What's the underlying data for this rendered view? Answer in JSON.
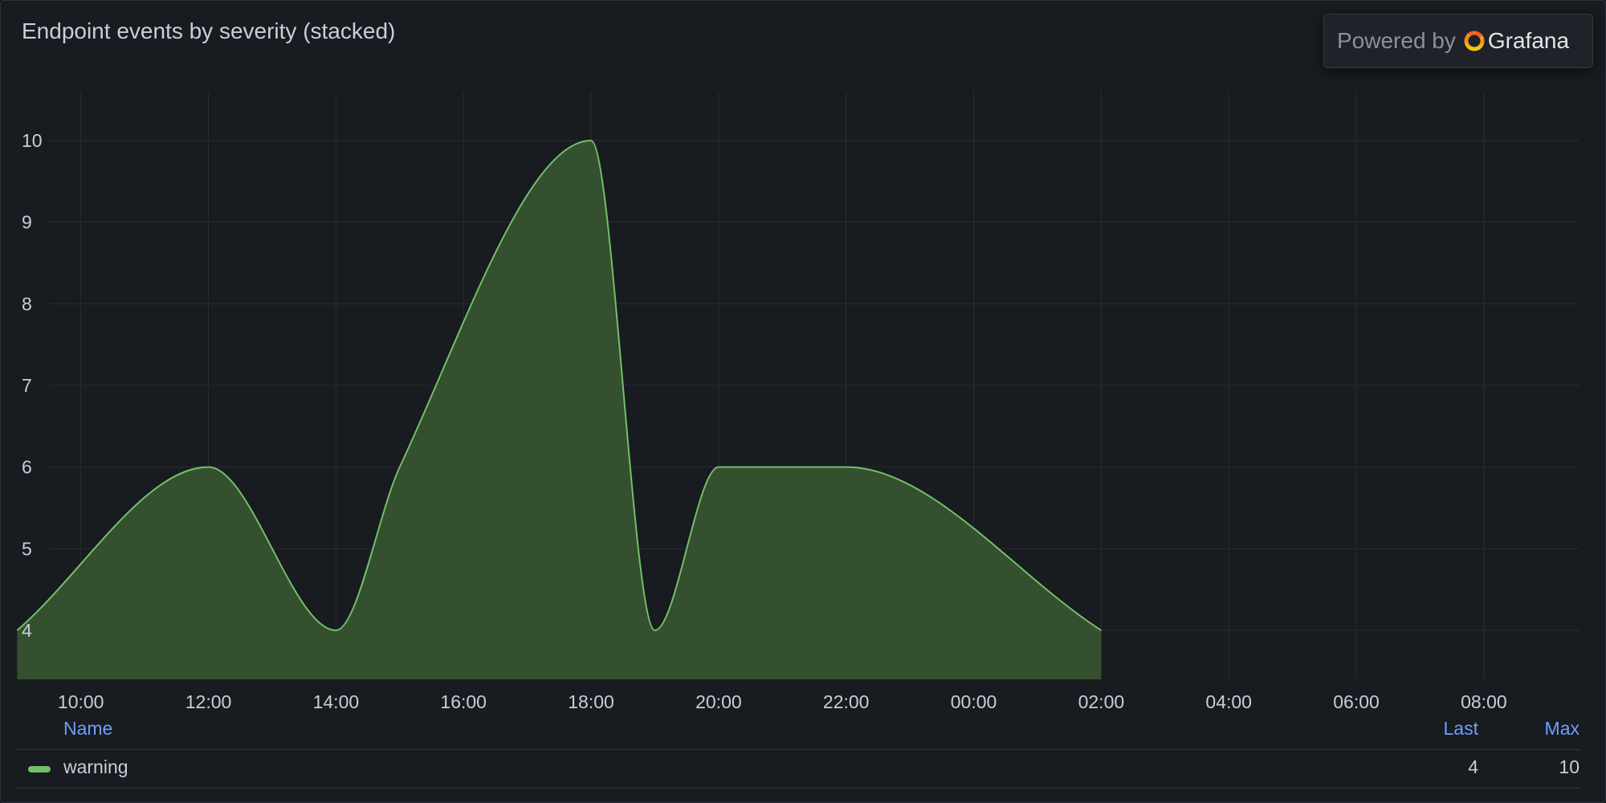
{
  "panel": {
    "title": "Endpoint events by severity (stacked)"
  },
  "badge": {
    "powered_label": "Powered by",
    "brand": "Grafana",
    "logo_icon": "grafana-logo-icon"
  },
  "colors": {
    "series_line": "#73bf69",
    "series_fill": "#34502f",
    "grid": "#2a2d33"
  },
  "chart_data": {
    "type": "area",
    "title": "Endpoint events by severity (stacked)",
    "xlabel": "",
    "ylabel": "",
    "stacked": true,
    "ylim": [
      3.4,
      10.6
    ],
    "yticks": [
      4,
      5,
      6,
      7,
      8,
      9,
      10
    ],
    "x_range_hours": [
      9.5,
      33.5
    ],
    "xticks": [
      {
        "label": "10:00",
        "hour": 10
      },
      {
        "label": "12:00",
        "hour": 12
      },
      {
        "label": "14:00",
        "hour": 14
      },
      {
        "label": "16:00",
        "hour": 16
      },
      {
        "label": "18:00",
        "hour": 18
      },
      {
        "label": "20:00",
        "hour": 20
      },
      {
        "label": "22:00",
        "hour": 22
      },
      {
        "label": "00:00",
        "hour": 24
      },
      {
        "label": "02:00",
        "hour": 26
      },
      {
        "label": "04:00",
        "hour": 28
      },
      {
        "label": "06:00",
        "hour": 30
      },
      {
        "label": "08:00",
        "hour": 32
      }
    ],
    "series": [
      {
        "name": "warning",
        "color": "#73bf69",
        "x": [
          "09:00",
          "12:00",
          "14:00",
          "15:00",
          "18:00",
          "19:00",
          "20:00",
          "22:00",
          "02:00"
        ],
        "x_hours": [
          9,
          12,
          14,
          15,
          18,
          19,
          20,
          22,
          26
        ],
        "values": [
          4,
          6,
          4,
          6,
          10,
          4,
          6,
          6,
          4
        ]
      }
    ],
    "legend": {
      "placement": "bottom",
      "columns": [
        "Name",
        "Last",
        "Max"
      ],
      "rows": [
        {
          "name": "warning",
          "last": "4",
          "max": "10"
        }
      ]
    }
  }
}
